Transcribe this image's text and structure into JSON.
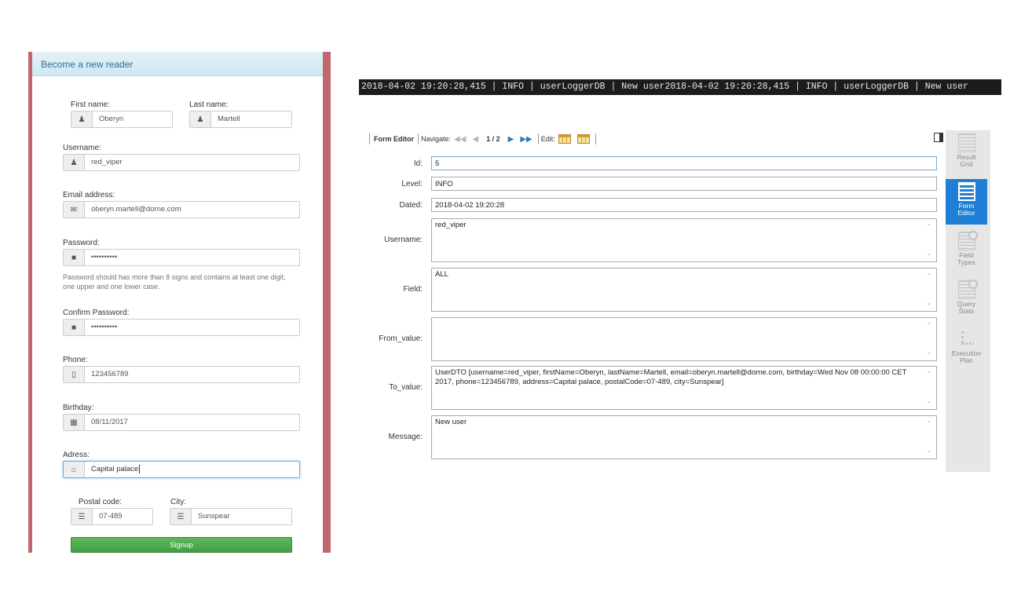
{
  "registration": {
    "header": "Become a new reader",
    "first_name": {
      "label": "First name:",
      "value": "Oberyn",
      "icon": "user-icon"
    },
    "last_name": {
      "label": "Last name:",
      "value": "Martell",
      "icon": "user-icon"
    },
    "username": {
      "label": "Username:",
      "value": "red_viper",
      "icon": "user-icon"
    },
    "email": {
      "label": "Email address:",
      "value": "oberyn.martell@dorne.com",
      "icon": "envelope-icon"
    },
    "password": {
      "label": "Password:",
      "value": "••••••••••",
      "icon": "lock-icon",
      "help_line1": "Password should has more than 8 signs and contains at least one digit,",
      "help_line2": "one upper and one lower case."
    },
    "confirm_password": {
      "label": "Confirm Password:",
      "value": "••••••••••",
      "icon": "lock-icon"
    },
    "phone": {
      "label": "Phone:",
      "value": "123456789",
      "icon": "phone-icon"
    },
    "birthday": {
      "label": "Birthday:",
      "value": "08/11/2017",
      "icon": "calendar-icon"
    },
    "address": {
      "label": "Adress:",
      "value": "Capital palace",
      "icon": "home-icon"
    },
    "postal_code": {
      "label": "Postal code:",
      "value": "07-489",
      "icon": "list-icon"
    },
    "city": {
      "label": "City:",
      "value": "Sunspear",
      "icon": "list-icon"
    },
    "signup_label": "Signup",
    "colors": {
      "frame": "#c0686e",
      "header_bg": "#d9edf7",
      "header_text": "#31708f",
      "signup": "#5cb85c"
    }
  },
  "log_line": "2018-04-02 19:20:28,415 | INFO | userLoggerDB | New user2018-04-02 19:20:28,415 | INFO | userLoggerDB | New user",
  "editor": {
    "toolbar": {
      "form_editor": "Form Editor",
      "navigate": "Navigate:",
      "page": "1 / 2",
      "edit": "Edit:"
    },
    "fields": {
      "id": {
        "label": "Id:",
        "value": "5"
      },
      "level": {
        "label": "Level:",
        "value": "INFO"
      },
      "dated": {
        "label": "Dated:",
        "value": "2018-04-02 19:20:28"
      },
      "username": {
        "label": "Username:",
        "value": "red_viper"
      },
      "field": {
        "label": "Field:",
        "value": "ALL"
      },
      "from_value": {
        "label": "From_value:",
        "value": ""
      },
      "to_value": {
        "label": "To_value:",
        "value": "UserDTO [username=red_viper, firstName=Oberyn, lastName=Martell, email=oberyn.martell@dorne.com, birthday=Wed Nov 08 00:00:00 CET 2017, phone=123456789, address=Capital palace, postalCode=07-489, city=Sunspear]"
      },
      "message": {
        "label": "Message:",
        "value": "New user"
      }
    }
  },
  "side_panel": {
    "result_grid_l1": "Result",
    "result_grid_l2": "Grid",
    "form_editor_l1": "Form",
    "form_editor_l2": "Editor",
    "field_types_l1": "Field",
    "field_types_l2": "Types",
    "query_stats_l1": "Query",
    "query_stats_l2": "Stats",
    "execution_plan_l1": "Execution",
    "execution_plan_l2": "Plan",
    "active_color": "#1f7fd6"
  }
}
